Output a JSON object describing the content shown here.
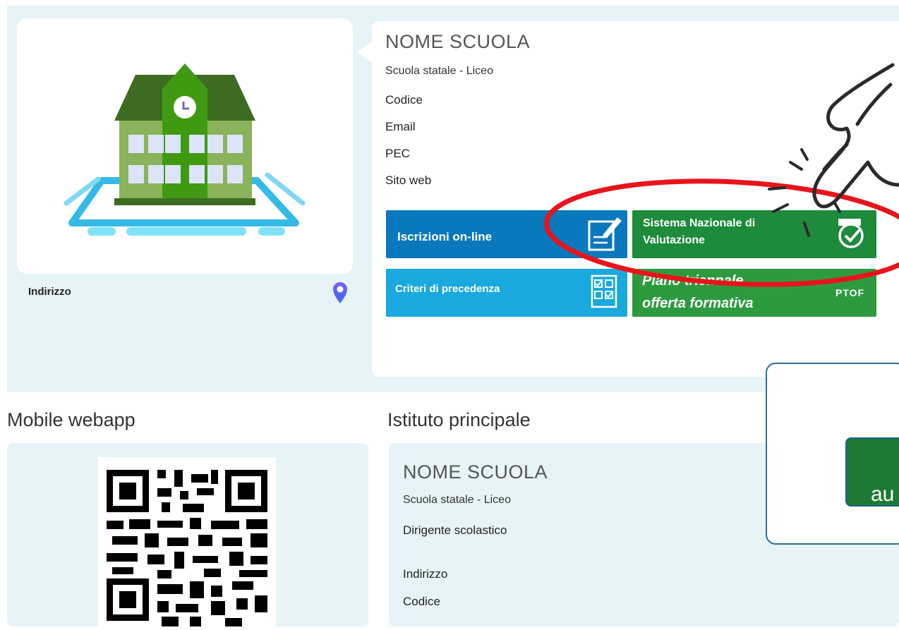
{
  "school": {
    "name": "NOME SCUOLA",
    "type": "Scuola statale - Liceo",
    "fields": [
      "Codice",
      "Email",
      "PEC",
      "Sito web"
    ],
    "address_label": "Indirizzo"
  },
  "tiles": [
    {
      "label": "Iscrizioni on-line",
      "icon": "form-edit-icon",
      "color": "#0a78bd"
    },
    {
      "label_line1": "Sistema Nazionale di",
      "label_line2": "Valutazione",
      "icon": "check-badge-icon",
      "color": "#1d8a3c"
    },
    {
      "label": "Criteri di precedenza",
      "icon": "checklist-icon",
      "color": "#1aa9de"
    },
    {
      "label_line1": "Piano triennale",
      "label_line2": "offerta formativa",
      "badge": "PTOF",
      "color": "#2e9a3f"
    }
  ],
  "sections": {
    "mobile_webapp": "Mobile webapp",
    "istituto_principale": "Istituto principale"
  },
  "istituto": {
    "name": "NOME SCUOLA",
    "type": "Scuola statale - Liceo",
    "fields": [
      "Dirigente scolastico",
      "Indirizzo",
      "Codice"
    ]
  },
  "popup": {
    "button_text_visible": "au"
  },
  "colors": {
    "band_bg": "#e6f4f8",
    "highlight_circle": "#e8141b"
  }
}
